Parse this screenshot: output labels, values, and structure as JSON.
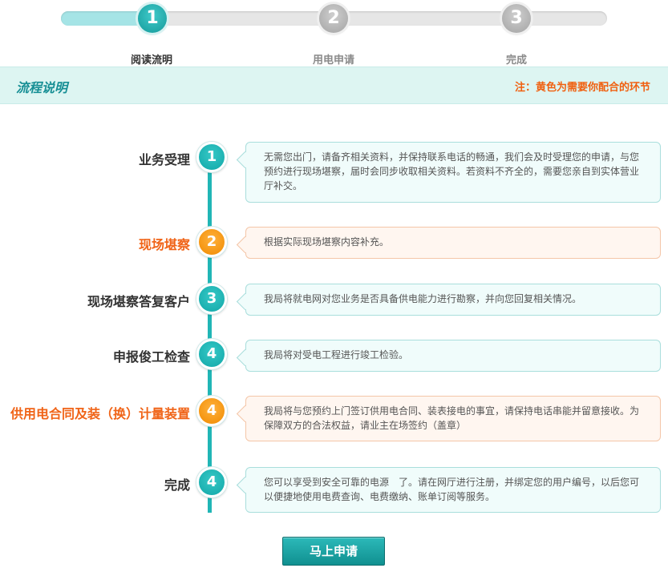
{
  "stepper": {
    "steps": [
      {
        "number": "1",
        "label": "阅读流明",
        "state": "active"
      },
      {
        "number": "2",
        "label": "用电申请",
        "state": "inactive"
      },
      {
        "number": "3",
        "label": "完成",
        "state": "inactive"
      }
    ]
  },
  "info_bar": {
    "title": "流程说明",
    "note": "注：黄色为需要你配合的环节"
  },
  "timeline": [
    {
      "label": "业务受理",
      "number": "1",
      "highlight": false,
      "text": "无需您出门，请备齐相关资料，并保持联系电话的畅通，我们会及时受理您的申请，与您预约进行现场堪察，届时会同步收取相关资料。若资料不齐全的，需要您亲自到实体营业厅补交。"
    },
    {
      "label": "现场堪察",
      "number": "2",
      "highlight": true,
      "text": "根据实际现场堪察内容补充。"
    },
    {
      "label": "现场堪察答复客户",
      "number": "3",
      "highlight": false,
      "text": "我局将就电网对您业务是否具备供电能力进行勘察，并向您回复相关情况。"
    },
    {
      "label": "申报俊工检查",
      "number": "4",
      "highlight": false,
      "text": "我局将对受电工程进行竣工检验。"
    },
    {
      "label": "供用电合同及装（换）计量装置",
      "number": "4",
      "highlight": true,
      "text": "我局将与您预约上门签订供用电合同、装表接电的事宜，请保持电话串能并留意接收。为保障双方的合法权益，请业主在场签约（盖章）"
    },
    {
      "label": "完成",
      "number": "4",
      "highlight": false,
      "text": "您可以享受到安全可靠的电源　了。请在网厅进行注册，并绑定您的用户编号，以后您可以便捷地使用电费查询、电费缴纳、账单订阅等服务。"
    }
  ],
  "apply_button": "马上申请",
  "colors": {
    "accent": "#20b6b6",
    "highlight": "#f08a00",
    "note": "#f06010"
  }
}
